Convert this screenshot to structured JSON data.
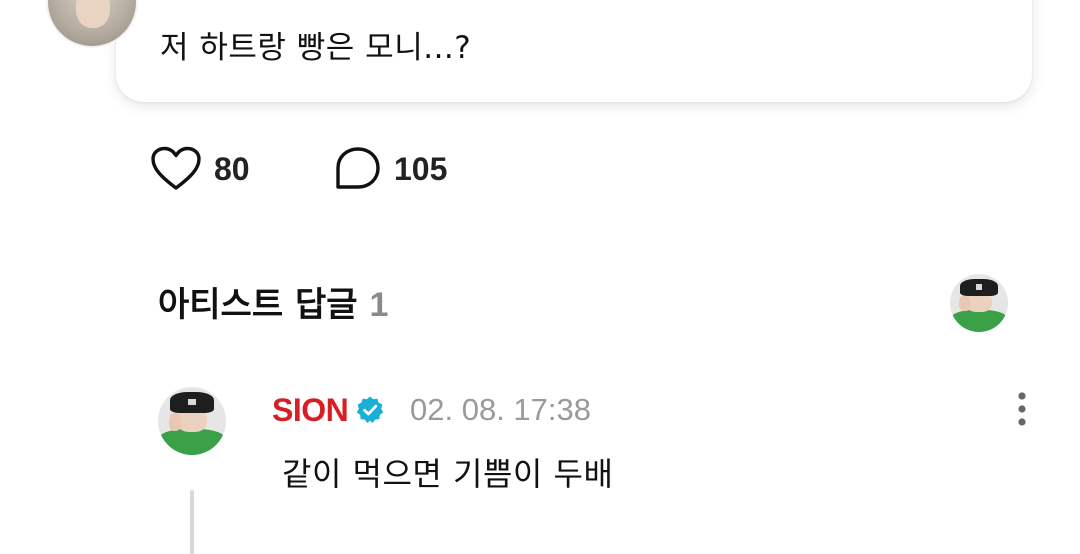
{
  "post": {
    "text": "저 하트랑 빵은 모니...?"
  },
  "actions": {
    "like_icon": "heart-outline-icon",
    "like_count": "80",
    "comment_icon": "speech-bubble-icon",
    "comment_count": "105"
  },
  "artist_replies": {
    "title": "아티스트 답글",
    "count": "1"
  },
  "reply": {
    "author": "SION",
    "verified_icon": "verified-badge-icon",
    "timestamp": "02. 08. 17:38",
    "text": "같이 먹으면 기쁨이 두배",
    "more_icon": "more-vertical-icon"
  },
  "colors": {
    "author": "#d81e25",
    "verified": "#1ab0d6",
    "muted": "#9a9a9a"
  }
}
